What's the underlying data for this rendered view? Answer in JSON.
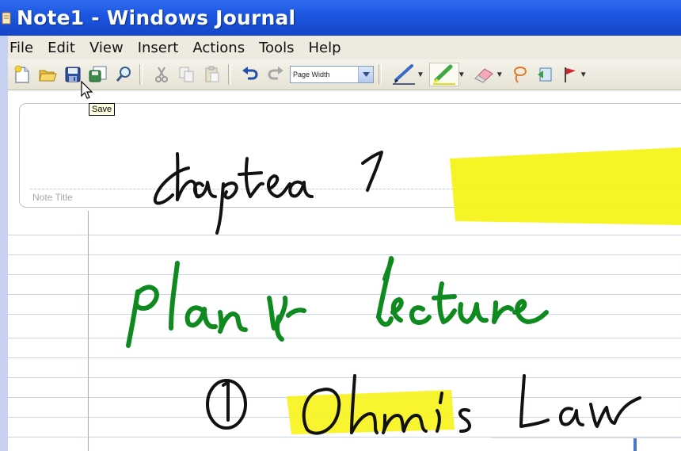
{
  "window": {
    "title": "Note1 - Windows Journal"
  },
  "menu": [
    {
      "label": "File"
    },
    {
      "label": "Edit"
    },
    {
      "label": "View"
    },
    {
      "label": "Insert"
    },
    {
      "label": "Actions"
    },
    {
      "label": "Tools"
    },
    {
      "label": "Help"
    }
  ],
  "toolbar": {
    "zoom_value": "Page Width",
    "tooltip": "Save",
    "icons": [
      "new-note-icon",
      "open-icon",
      "save-icon",
      "save-as-icon",
      "find-icon",
      "cut-icon",
      "copy-icon",
      "paste-icon",
      "undo-icon",
      "redo-icon",
      "pen-icon",
      "highlighter-icon",
      "eraser-icon",
      "lasso-icon",
      "insert-space-icon",
      "flag-icon"
    ]
  },
  "note": {
    "title_label": "Note Title",
    "ink_colors": {
      "pen": "#111111",
      "green": "#0f8a1e",
      "highlight": "#f7f31a"
    }
  }
}
